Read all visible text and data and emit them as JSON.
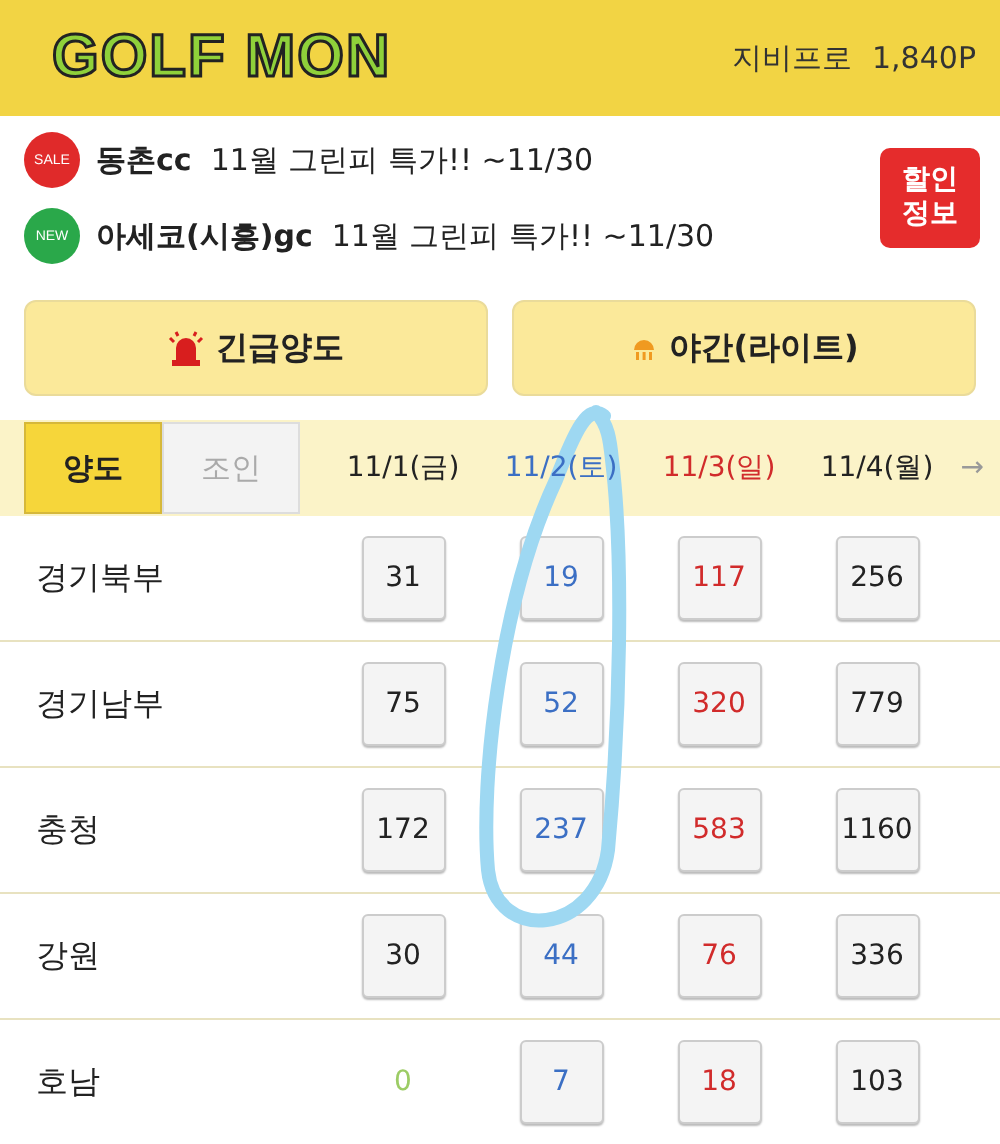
{
  "header": {
    "logo": "GOLF MON",
    "user": "지비프로",
    "points": "1,840P"
  },
  "promos": [
    {
      "badge": "SALE",
      "kind": "sale",
      "name": "동촌cc",
      "text": "11월 그린피 특가!! ~11/30"
    },
    {
      "badge": "NEW",
      "kind": "new",
      "name": "아세코(시흥)gc",
      "text": "11월 그린피 특가!! ~11/30"
    }
  ],
  "promo_button": "할인 정보",
  "actions": [
    {
      "label": "긴급양도",
      "kind": "siren"
    },
    {
      "label": "야간(라이트)",
      "kind": "light"
    }
  ],
  "tabs": [
    {
      "label": "양도",
      "selected": true
    },
    {
      "label": "조인",
      "selected": false
    }
  ],
  "dates": [
    {
      "label": "11/1(금)",
      "kind": "weekday"
    },
    {
      "label": "11/2(토)",
      "kind": "saturday"
    },
    {
      "label": "11/3(일)",
      "kind": "sunday"
    },
    {
      "label": "11/4(월)",
      "kind": "weekday"
    }
  ],
  "next_arrow": "→",
  "rows": [
    {
      "region": "경기북부",
      "counts": [
        {
          "value": "31",
          "kind": "button"
        },
        {
          "value": "19",
          "kind": "button"
        },
        {
          "value": "117",
          "kind": "button"
        },
        {
          "value": "256",
          "kind": "button"
        }
      ]
    },
    {
      "region": "경기남부",
      "counts": [
        {
          "value": "75",
          "kind": "button"
        },
        {
          "value": "52",
          "kind": "button"
        },
        {
          "value": "320",
          "kind": "button"
        },
        {
          "value": "779",
          "kind": "button"
        }
      ]
    },
    {
      "region": "충청",
      "counts": [
        {
          "value": "172",
          "kind": "button"
        },
        {
          "value": "237",
          "kind": "button"
        },
        {
          "value": "583",
          "kind": "button"
        },
        {
          "value": "1160",
          "kind": "button"
        }
      ]
    },
    {
      "region": "강원",
      "counts": [
        {
          "value": "30",
          "kind": "button"
        },
        {
          "value": "44",
          "kind": "button"
        },
        {
          "value": "76",
          "kind": "button"
        },
        {
          "value": "336",
          "kind": "button"
        }
      ]
    },
    {
      "region": "호남",
      "counts": [
        {
          "value": "0",
          "kind": "plain"
        },
        {
          "value": "7",
          "kind": "button"
        },
        {
          "value": "18",
          "kind": "button"
        },
        {
          "value": "103",
          "kind": "button"
        }
      ]
    }
  ]
}
